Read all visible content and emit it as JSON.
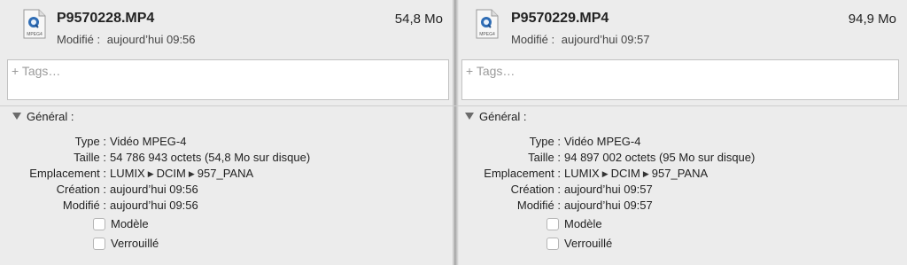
{
  "panels": [
    {
      "filename": "P9570228.MP4",
      "size": "54,8 Mo",
      "modified_label": "Modifié :",
      "modified_value": "aujourd’hui 09:56",
      "tags_placeholder": "+ Tags…",
      "section_title": "Général :",
      "icon_label": "MPEG4",
      "fields": [
        {
          "label": "Type :",
          "value": "Vidéo MPEG-4"
        },
        {
          "label": "Taille :",
          "value": "54 786 943 octets (54,8 Mo sur disque)"
        },
        {
          "label": "Emplacement :",
          "path": [
            "LUMIX",
            "DCIM",
            "957_PANA"
          ]
        },
        {
          "label": "Création :",
          "value": "aujourd’hui 09:56"
        },
        {
          "label": "Modifié :",
          "value": "aujourd’hui 09:56"
        }
      ],
      "checkboxes": [
        {
          "label": "Modèle",
          "checked": false
        },
        {
          "label": "Verrouillé",
          "checked": false
        }
      ]
    },
    {
      "filename": "P9570229.MP4",
      "size": "94,9 Mo",
      "modified_label": "Modifié :",
      "modified_value": "aujourd’hui 09:57",
      "tags_placeholder": "+ Tags…",
      "section_title": "Général :",
      "icon_label": "MPEG4",
      "fields": [
        {
          "label": "Type :",
          "value": "Vidéo MPEG-4"
        },
        {
          "label": "Taille :",
          "value": "94 897 002 octets (95 Mo sur disque)"
        },
        {
          "label": "Emplacement :",
          "path": [
            "LUMIX",
            "DCIM",
            "957_PANA"
          ]
        },
        {
          "label": "Création :",
          "value": "aujourd’hui 09:57"
        },
        {
          "label": "Modifié :",
          "value": "aujourd’hui 09:57"
        }
      ],
      "checkboxes": [
        {
          "label": "Modèle",
          "checked": false
        },
        {
          "label": "Verrouillé",
          "checked": false
        }
      ]
    }
  ],
  "colors": {
    "background": "#ececec",
    "placeholder": "#9b9b9b",
    "icon_accent": "#2f6db5"
  },
  "icons": {
    "file": "mpeg4-file-icon",
    "disclosure": "disclosure-triangle-icon",
    "path_separator": "chevron-right-icon"
  }
}
